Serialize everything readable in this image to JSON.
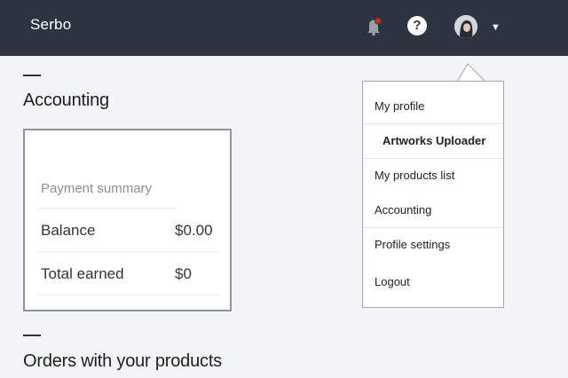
{
  "header": {
    "brand": "Serbo",
    "notification_color": "#e02424",
    "help_label": "?",
    "caret": "▼"
  },
  "accounting": {
    "title": "Accounting",
    "summary_title": "Payment summary",
    "rows": [
      {
        "label": "Balance",
        "value": "$0.00"
      },
      {
        "label": "Total earned",
        "value": "$0"
      }
    ]
  },
  "orders": {
    "title": "Orders with your products"
  },
  "menu": {
    "items": [
      {
        "label": "My profile"
      },
      {
        "label": "Artworks Uploader"
      },
      {
        "label": "My products list"
      },
      {
        "label": "Accounting"
      },
      {
        "label": "Profile settings"
      },
      {
        "label": "Logout"
      }
    ]
  }
}
